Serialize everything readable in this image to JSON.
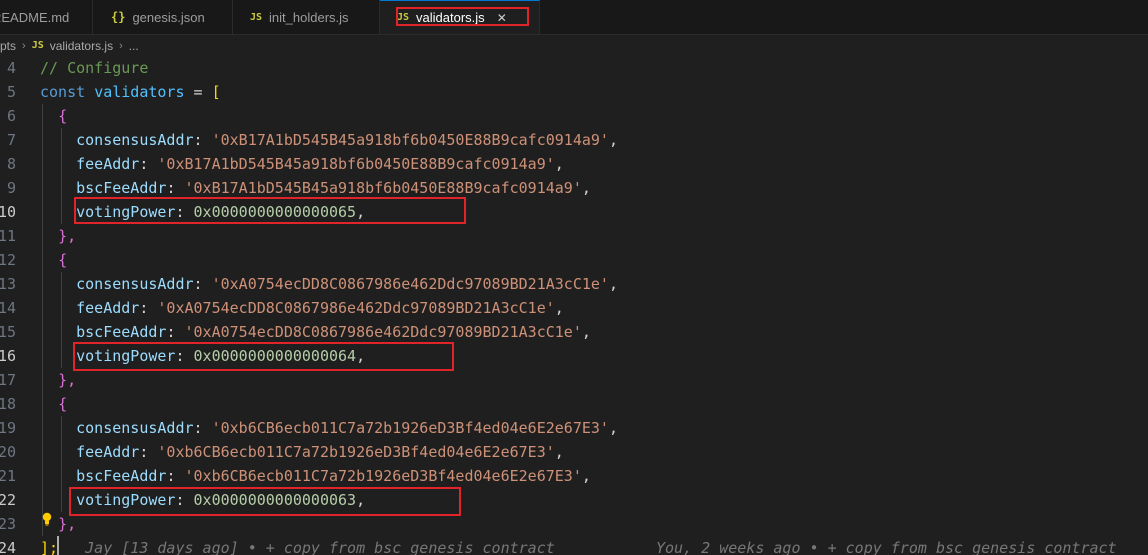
{
  "tabs": [
    {
      "icon": "",
      "label": "README.md"
    },
    {
      "icon": "{}",
      "label": "genesis.json"
    },
    {
      "icon": "JS",
      "label": "init_holders.js"
    },
    {
      "icon": "JS",
      "label": "validators.js",
      "close": "✕"
    }
  ],
  "breadcrumb": {
    "folder": "pts",
    "sep1": "›",
    "file_icon": "JS",
    "file": "validators.js",
    "sep2": "›",
    "more": "..."
  },
  "editor": {
    "gutter": [
      "4",
      "5",
      "6",
      "7",
      "8",
      "9",
      "10",
      "11",
      "12",
      "13",
      "14",
      "15",
      "16",
      "17",
      "18",
      "19",
      "20",
      "21",
      "22",
      "23",
      "24"
    ],
    "comment": "// Configure",
    "kw_const": "const",
    "var_name": "validators",
    "eq": " = ",
    "open_bracket": "[",
    "open_brace": "{",
    "close_brace": "},",
    "close_bracket": "];",
    "keys": {
      "consensus": "consensusAddr",
      "fee": "feeAddr",
      "bscfee": "bscFeeAddr",
      "power": "votingPower"
    },
    "colon": ": ",
    "comma": ",",
    "validators": [
      {
        "consensusAddr": "'0xB17A1bD545B45a918bf6b0450E88B9cafc0914a9'",
        "feeAddr": "'0xB17A1bD545B45a918bf6b0450E88B9cafc0914a9'",
        "bscFeeAddr": "'0xB17A1bD545B45a918bf6b0450E88B9cafc0914a9'",
        "votingPower": "0x0000000000000065"
      },
      {
        "consensusAddr": "'0xA0754ecDD8C0867986e462Ddc97089BD21A3cC1e'",
        "feeAddr": "'0xA0754ecDD8C0867986e462Ddc97089BD21A3cC1e'",
        "bscFeeAddr": "'0xA0754ecDD8C0867986e462Ddc97089BD21A3cC1e'",
        "votingPower": "0x0000000000000064"
      },
      {
        "consensusAddr": "'0xb6CB6ecb011C7a72b1926eD3Bf4ed04e6E2e67E3'",
        "feeAddr": "'0xb6CB6ecb011C7a72b1926eD3Bf4ed04e6E2e67E3'",
        "bscFeeAddr": "'0xb6CB6ecb011C7a72b1926eD3Bf4ed04e6E2e67E3'",
        "votingPower": "0x0000000000000063"
      }
    ],
    "blame_left": "Jay [13 days ago] • + copy from bsc genesis contract",
    "blame_right": "You, 2 weeks ago • + copy from bsc genesis contract"
  },
  "colors": {
    "highlight_box": "#e0242a",
    "keyword": "#569cd6",
    "string": "#ce9178",
    "number": "#b5cea8",
    "property": "#9cdcfe"
  }
}
